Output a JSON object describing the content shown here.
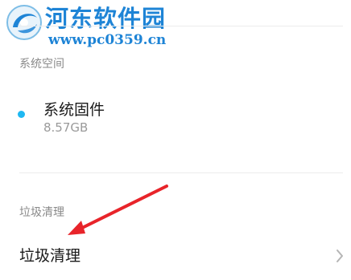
{
  "watermark": {
    "title": "河东软件园",
    "url": "www.pc0359.cn",
    "logo_icon": "swirl-logo-icon"
  },
  "storage_section": {
    "header": "系统空间",
    "item": {
      "title": "系统固件",
      "size": "8.57GB",
      "dot_color": "#1fb8f2",
      "dot_icon": "dot-indicator-icon"
    }
  },
  "clean_section": {
    "header": "垃圾清理",
    "row_label": "垃圾清理",
    "chevron_icon": "chevron-right-icon"
  },
  "annotation": {
    "arrow_color": "#e8242a",
    "arrow_icon": "red-arrow-icon"
  }
}
